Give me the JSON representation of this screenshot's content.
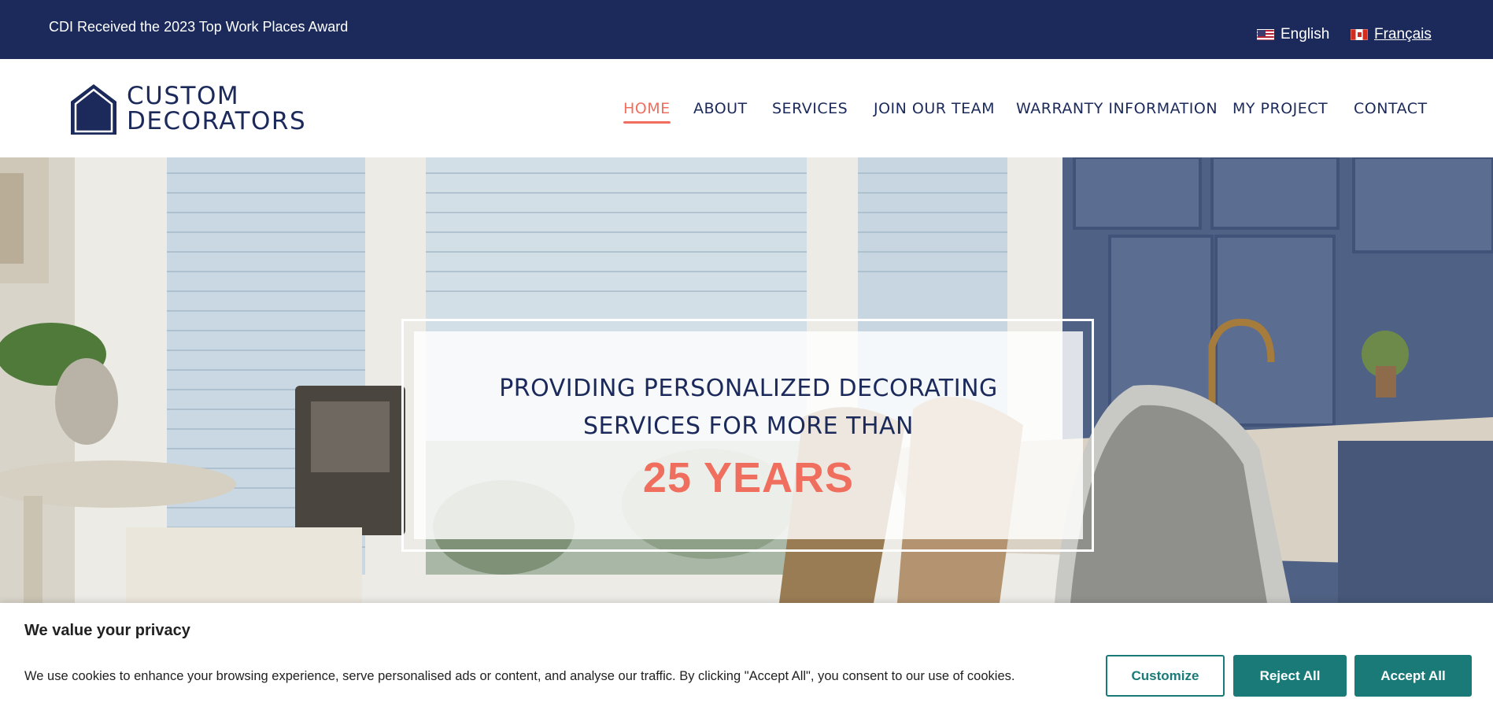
{
  "topbar": {
    "award_text": "CDI Received the 2023 Top Work Places Award",
    "languages": [
      {
        "label": "English",
        "flag": "us-flag-icon"
      },
      {
        "label": "Français",
        "flag": "canada-flag-icon"
      }
    ]
  },
  "logo": {
    "line1": "CUSTOM",
    "line2": "DECORATORS"
  },
  "nav": {
    "items": [
      {
        "label": "HOME",
        "active": true
      },
      {
        "label": "ABOUT"
      },
      {
        "label": "SERVICES"
      },
      {
        "label": "JOIN OUR TEAM"
      },
      {
        "label": "WARRANTY INFORMATION"
      },
      {
        "label": "MY PROJECT"
      },
      {
        "label": "CONTACT"
      }
    ]
  },
  "hero": {
    "line1": "PROVIDING PERSONALIZED DECORATING",
    "line2": "SERVICES FOR MORE THAN",
    "highlight": "25 YEARS"
  },
  "cookie_banner": {
    "title": "We value your privacy",
    "text": "We use cookies to enhance your browsing experience, serve personalised ads or content, and analyse our traffic. By clicking \"Accept All\", you consent to our use of cookies.",
    "customize_label": "Customize",
    "reject_label": "Reject All",
    "accept_label": "Accept All"
  },
  "colors": {
    "navy": "#1b2a5a",
    "coral": "#ef6e5e",
    "teal": "#1a7a78"
  }
}
